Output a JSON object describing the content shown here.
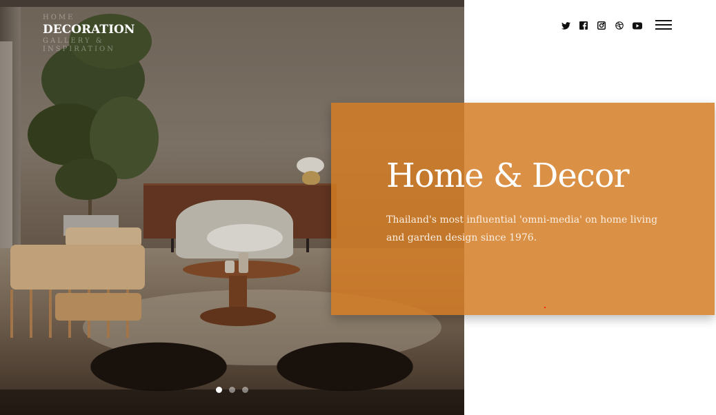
{
  "logo": {
    "line1": "HOME",
    "title": "DECORATION",
    "line3": "GALLERY &",
    "line4": "INSPIRATION"
  },
  "hero": {
    "headline": "Home & Decor",
    "tagline": "Thailand's most influential 'omni-media' on home living and garden design since 1976.",
    "accent_color": "#d47d25",
    "slides_total": 3,
    "slide_active": 1
  },
  "social": [
    {
      "name": "twitter-icon"
    },
    {
      "name": "facebook-icon"
    },
    {
      "name": "instagram-icon"
    },
    {
      "name": "dribbble-icon"
    },
    {
      "name": "youtube-icon"
    }
  ],
  "menu": {
    "icon": "hamburger-menu-icon"
  }
}
